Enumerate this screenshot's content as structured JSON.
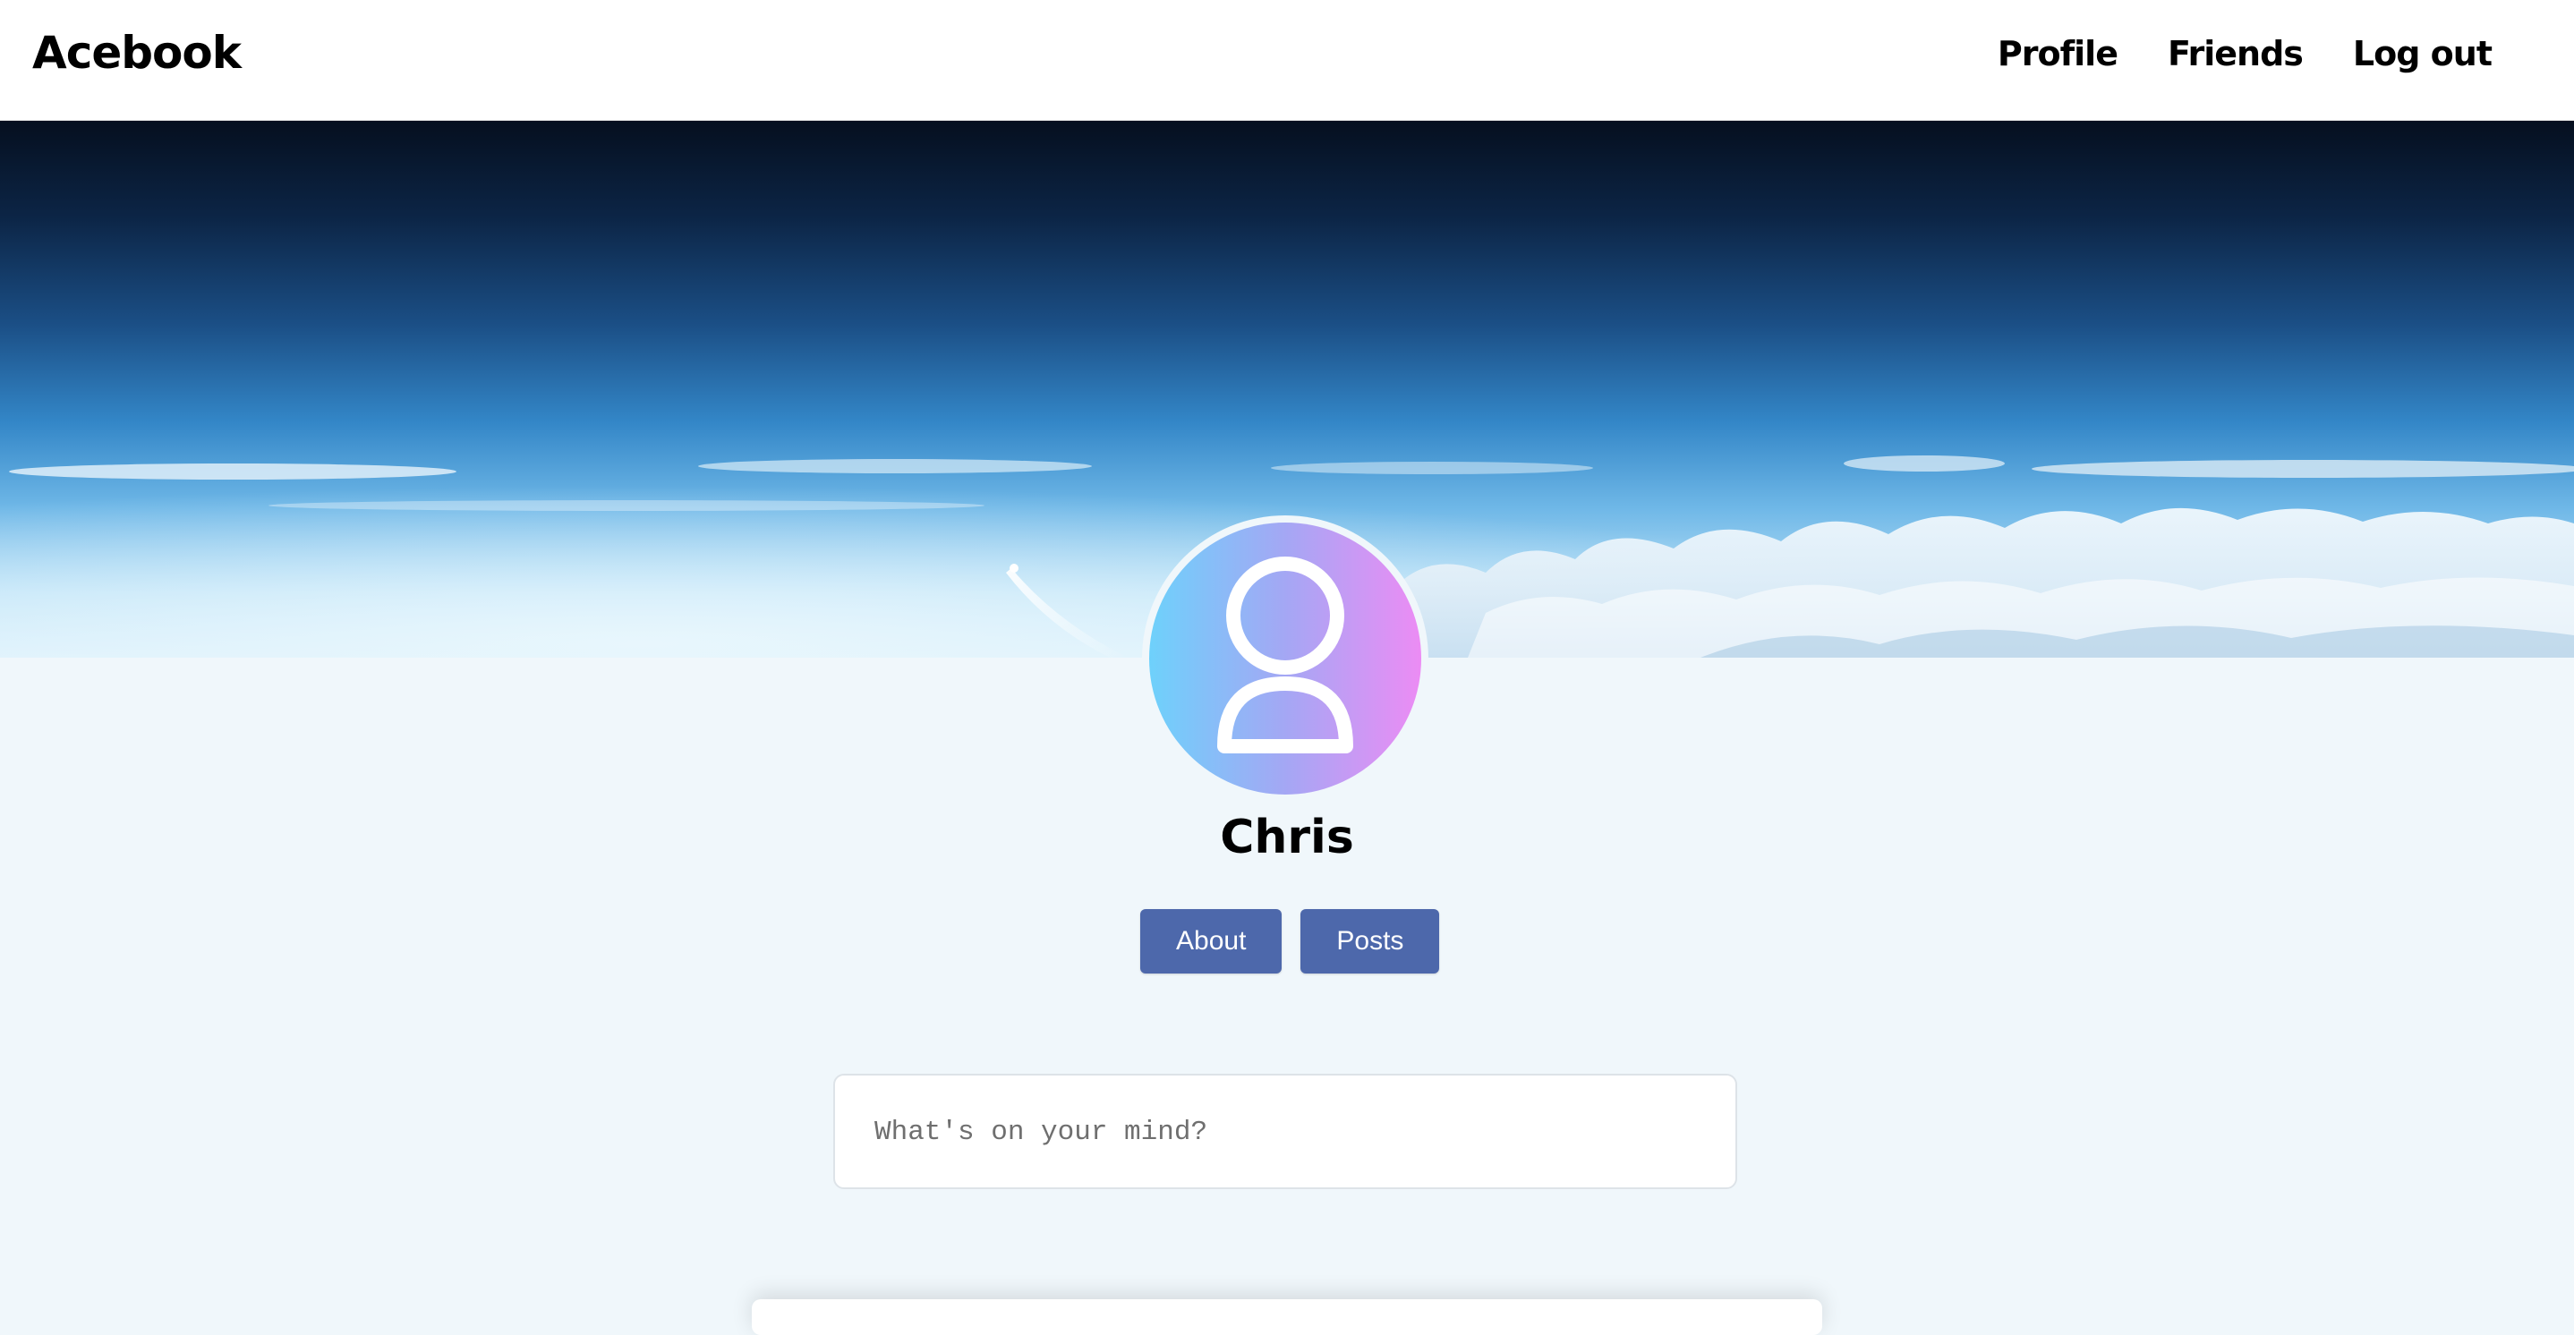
{
  "navbar": {
    "brand": "Acebook",
    "links": [
      {
        "label": "Profile"
      },
      {
        "label": "Friends"
      },
      {
        "label": "Log out"
      }
    ]
  },
  "profile": {
    "name": "Chris",
    "tabs": [
      {
        "label": "About"
      },
      {
        "label": "Posts"
      }
    ]
  },
  "composer": {
    "placeholder": "What's on your mind?"
  },
  "colors": {
    "button": "#4d68ab",
    "page_background": "#f0f7fb",
    "avatar_gradient_start": "#6ed1fb",
    "avatar_gradient_end": "#ec8cf4"
  },
  "icons": {
    "avatar": "user-silhouette-icon"
  }
}
